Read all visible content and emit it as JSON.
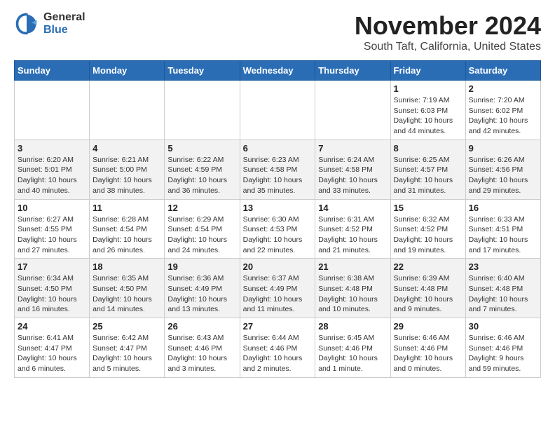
{
  "logo": {
    "general": "General",
    "blue": "Blue"
  },
  "title": "November 2024",
  "location": "South Taft, California, United States",
  "days_of_week": [
    "Sunday",
    "Monday",
    "Tuesday",
    "Wednesday",
    "Thursday",
    "Friday",
    "Saturday"
  ],
  "weeks": [
    [
      {
        "day": "",
        "info": ""
      },
      {
        "day": "",
        "info": ""
      },
      {
        "day": "",
        "info": ""
      },
      {
        "day": "",
        "info": ""
      },
      {
        "day": "",
        "info": ""
      },
      {
        "day": "1",
        "info": "Sunrise: 7:19 AM\nSunset: 6:03 PM\nDaylight: 10 hours and 44 minutes."
      },
      {
        "day": "2",
        "info": "Sunrise: 7:20 AM\nSunset: 6:02 PM\nDaylight: 10 hours and 42 minutes."
      }
    ],
    [
      {
        "day": "3",
        "info": "Sunrise: 6:20 AM\nSunset: 5:01 PM\nDaylight: 10 hours and 40 minutes."
      },
      {
        "day": "4",
        "info": "Sunrise: 6:21 AM\nSunset: 5:00 PM\nDaylight: 10 hours and 38 minutes."
      },
      {
        "day": "5",
        "info": "Sunrise: 6:22 AM\nSunset: 4:59 PM\nDaylight: 10 hours and 36 minutes."
      },
      {
        "day": "6",
        "info": "Sunrise: 6:23 AM\nSunset: 4:58 PM\nDaylight: 10 hours and 35 minutes."
      },
      {
        "day": "7",
        "info": "Sunrise: 6:24 AM\nSunset: 4:58 PM\nDaylight: 10 hours and 33 minutes."
      },
      {
        "day": "8",
        "info": "Sunrise: 6:25 AM\nSunset: 4:57 PM\nDaylight: 10 hours and 31 minutes."
      },
      {
        "day": "9",
        "info": "Sunrise: 6:26 AM\nSunset: 4:56 PM\nDaylight: 10 hours and 29 minutes."
      }
    ],
    [
      {
        "day": "10",
        "info": "Sunrise: 6:27 AM\nSunset: 4:55 PM\nDaylight: 10 hours and 27 minutes."
      },
      {
        "day": "11",
        "info": "Sunrise: 6:28 AM\nSunset: 4:54 PM\nDaylight: 10 hours and 26 minutes."
      },
      {
        "day": "12",
        "info": "Sunrise: 6:29 AM\nSunset: 4:54 PM\nDaylight: 10 hours and 24 minutes."
      },
      {
        "day": "13",
        "info": "Sunrise: 6:30 AM\nSunset: 4:53 PM\nDaylight: 10 hours and 22 minutes."
      },
      {
        "day": "14",
        "info": "Sunrise: 6:31 AM\nSunset: 4:52 PM\nDaylight: 10 hours and 21 minutes."
      },
      {
        "day": "15",
        "info": "Sunrise: 6:32 AM\nSunset: 4:52 PM\nDaylight: 10 hours and 19 minutes."
      },
      {
        "day": "16",
        "info": "Sunrise: 6:33 AM\nSunset: 4:51 PM\nDaylight: 10 hours and 17 minutes."
      }
    ],
    [
      {
        "day": "17",
        "info": "Sunrise: 6:34 AM\nSunset: 4:50 PM\nDaylight: 10 hours and 16 minutes."
      },
      {
        "day": "18",
        "info": "Sunrise: 6:35 AM\nSunset: 4:50 PM\nDaylight: 10 hours and 14 minutes."
      },
      {
        "day": "19",
        "info": "Sunrise: 6:36 AM\nSunset: 4:49 PM\nDaylight: 10 hours and 13 minutes."
      },
      {
        "day": "20",
        "info": "Sunrise: 6:37 AM\nSunset: 4:49 PM\nDaylight: 10 hours and 11 minutes."
      },
      {
        "day": "21",
        "info": "Sunrise: 6:38 AM\nSunset: 4:48 PM\nDaylight: 10 hours and 10 minutes."
      },
      {
        "day": "22",
        "info": "Sunrise: 6:39 AM\nSunset: 4:48 PM\nDaylight: 10 hours and 9 minutes."
      },
      {
        "day": "23",
        "info": "Sunrise: 6:40 AM\nSunset: 4:48 PM\nDaylight: 10 hours and 7 minutes."
      }
    ],
    [
      {
        "day": "24",
        "info": "Sunrise: 6:41 AM\nSunset: 4:47 PM\nDaylight: 10 hours and 6 minutes."
      },
      {
        "day": "25",
        "info": "Sunrise: 6:42 AM\nSunset: 4:47 PM\nDaylight: 10 hours and 5 minutes."
      },
      {
        "day": "26",
        "info": "Sunrise: 6:43 AM\nSunset: 4:46 PM\nDaylight: 10 hours and 3 minutes."
      },
      {
        "day": "27",
        "info": "Sunrise: 6:44 AM\nSunset: 4:46 PM\nDaylight: 10 hours and 2 minutes."
      },
      {
        "day": "28",
        "info": "Sunrise: 6:45 AM\nSunset: 4:46 PM\nDaylight: 10 hours and 1 minute."
      },
      {
        "day": "29",
        "info": "Sunrise: 6:46 AM\nSunset: 4:46 PM\nDaylight: 10 hours and 0 minutes."
      },
      {
        "day": "30",
        "info": "Sunrise: 6:46 AM\nSunset: 4:46 PM\nDaylight: 9 hours and 59 minutes."
      }
    ]
  ]
}
